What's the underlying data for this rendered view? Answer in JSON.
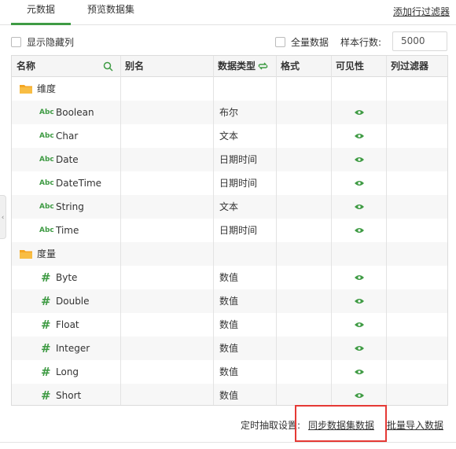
{
  "tabs": [
    {
      "label": "元数据",
      "active": true
    },
    {
      "label": "预览数据集",
      "active": false
    }
  ],
  "add_filter_label": "添加行过滤器",
  "options": {
    "show_hidden_label": "显示隐藏列",
    "full_data_label": "全量数据",
    "sample_rows_label": "样本行数:",
    "sample_rows_value": "5000"
  },
  "columns": [
    "名称",
    "别名",
    "数据类型",
    "格式",
    "可见性",
    "列过滤器"
  ],
  "groups": {
    "dimension_label": "维度",
    "measure_label": "度量"
  },
  "dimension_rows": [
    {
      "name": "Boolean",
      "type": "布尔",
      "type_icon": "abc-icon",
      "visible": true
    },
    {
      "name": "Char",
      "type": "文本",
      "type_icon": "abc-icon",
      "visible": true
    },
    {
      "name": "Date",
      "type": "日期时间",
      "type_icon": "abc-icon",
      "visible": true
    },
    {
      "name": "DateTime",
      "type": "日期时间",
      "type_icon": "abc-icon",
      "visible": true
    },
    {
      "name": "String",
      "type": "文本",
      "type_icon": "abc-icon",
      "visible": true
    },
    {
      "name": "Time",
      "type": "日期时间",
      "type_icon": "abc-icon",
      "visible": true
    }
  ],
  "measure_rows": [
    {
      "name": "Byte",
      "type": "数值",
      "type_icon": "hash-icon",
      "visible": true
    },
    {
      "name": "Double",
      "type": "数值",
      "type_icon": "hash-icon",
      "visible": true
    },
    {
      "name": "Float",
      "type": "数值",
      "type_icon": "hash-icon",
      "visible": true
    },
    {
      "name": "Integer",
      "type": "数值",
      "type_icon": "hash-icon",
      "visible": true
    },
    {
      "name": "Long",
      "type": "数值",
      "type_icon": "hash-icon",
      "visible": true
    },
    {
      "name": "Short",
      "type": "数值",
      "type_icon": "hash-icon",
      "visible": true
    }
  ],
  "abc_text": "Abc",
  "hash_text": "#",
  "footer": {
    "schedule_label": "定时抽取设置:",
    "sync_link": "同步数据集数据",
    "batch_import_link": "批量导入数据"
  },
  "side_handle_glyph": "‹",
  "colors": {
    "accent": "#3f9b44",
    "highlight": "#e53935"
  }
}
